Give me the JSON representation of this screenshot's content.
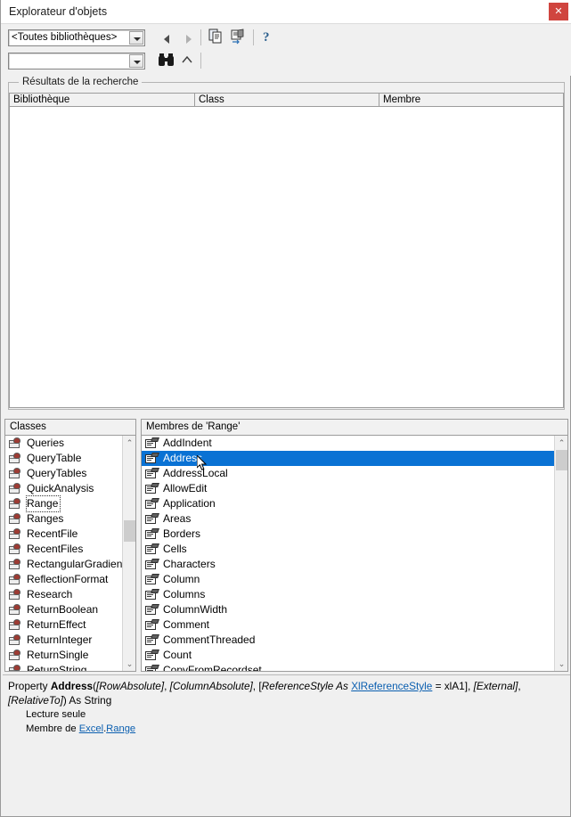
{
  "window": {
    "title": "Explorateur d'objets",
    "close_label": "✕",
    "close_color": "#d0453f"
  },
  "toolbar": {
    "library_combo": {
      "value": "<Toutes bibliothèques>",
      "placeholder": ""
    },
    "search_combo": {
      "value": "",
      "placeholder": ""
    },
    "buttons": [
      {
        "name": "back-button",
        "icon": "triangle-left-icon",
        "tooltip": "Précédent",
        "enabled": true
      },
      {
        "name": "forward-button",
        "icon": "triangle-right-icon",
        "tooltip": "Suivant",
        "enabled": false
      },
      {
        "name": "copy-button",
        "icon": "copy-icon",
        "tooltip": "Copier",
        "enabled": true
      },
      {
        "name": "view-definition-button",
        "icon": "view-definition-icon",
        "tooltip": "Afficher la définition",
        "enabled": true
      },
      {
        "name": "help-button",
        "icon": "question-mark-icon",
        "tooltip": "Aide",
        "enabled": true
      },
      {
        "name": "search-button",
        "icon": "binoculars-icon",
        "tooltip": "Rechercher",
        "enabled": true
      },
      {
        "name": "toggle-results-button",
        "icon": "chevron-up-icon",
        "tooltip": "Masquer les résultats",
        "enabled": true
      }
    ]
  },
  "results": {
    "group_label": "Résultats de la recherche",
    "columns": [
      "Bibliothèque",
      "Class",
      "Membre"
    ],
    "rows": []
  },
  "classes_panel": {
    "header": "Classes",
    "items": [
      {
        "label": "Queries",
        "icon": "class-icon"
      },
      {
        "label": "QueryTable",
        "icon": "class-icon"
      },
      {
        "label": "QueryTables",
        "icon": "class-icon"
      },
      {
        "label": "QuickAnalysis",
        "icon": "class-icon"
      },
      {
        "label": "Range",
        "icon": "class-icon",
        "focused": true
      },
      {
        "label": "Ranges",
        "icon": "class-icon"
      },
      {
        "label": "RecentFile",
        "icon": "class-icon"
      },
      {
        "label": "RecentFiles",
        "icon": "class-icon"
      },
      {
        "label": "RectangularGradien",
        "icon": "class-icon"
      },
      {
        "label": "ReflectionFormat",
        "icon": "class-icon"
      },
      {
        "label": "Research",
        "icon": "class-icon"
      },
      {
        "label": "ReturnBoolean",
        "icon": "class-icon"
      },
      {
        "label": "ReturnEffect",
        "icon": "class-icon"
      },
      {
        "label": "ReturnInteger",
        "icon": "class-icon"
      },
      {
        "label": "ReturnSingle",
        "icon": "class-icon"
      },
      {
        "label": "ReturnString",
        "icon": "class-icon"
      }
    ],
    "scrollbar": {
      "up": "⌃",
      "down": "⌄",
      "thumb_top_pct": 34,
      "thumb_height_pct": 10
    }
  },
  "members_panel": {
    "header": "Membres de 'Range'",
    "selected": "Address",
    "items": [
      {
        "label": "AddIndent",
        "icon": "property-icon"
      },
      {
        "label": "Address",
        "icon": "property-icon",
        "selected": true
      },
      {
        "label": "AddressLocal",
        "icon": "property-icon"
      },
      {
        "label": "AllowEdit",
        "icon": "property-icon"
      },
      {
        "label": "Application",
        "icon": "property-icon"
      },
      {
        "label": "Areas",
        "icon": "property-icon"
      },
      {
        "label": "Borders",
        "icon": "property-icon"
      },
      {
        "label": "Cells",
        "icon": "property-icon"
      },
      {
        "label": "Characters",
        "icon": "property-icon"
      },
      {
        "label": "Column",
        "icon": "property-icon"
      },
      {
        "label": "Columns",
        "icon": "property-icon"
      },
      {
        "label": "ColumnWidth",
        "icon": "property-icon"
      },
      {
        "label": "Comment",
        "icon": "property-icon"
      },
      {
        "label": "CommentThreaded",
        "icon": "property-icon"
      },
      {
        "label": "Count",
        "icon": "property-icon"
      },
      {
        "label": "CopyFromRecordset",
        "icon": "property-icon"
      }
    ],
    "scrollbar": {
      "up": "⌃",
      "down": "⌄",
      "thumb_top_pct": 0,
      "thumb_height_pct": 10
    }
  },
  "detail": {
    "keyword_property": "Property",
    "member_name": "Address",
    "signature_parts": {
      "open": "(",
      "p1": "[RowAbsolute]",
      "sep1": ", ",
      "p2": "[ColumnAbsolute]",
      "sep2": ", ",
      "p3_open": "[",
      "p3_name": "ReferenceStyle",
      "p3_as": " As ",
      "p3_type": "XlReferenceStyle",
      "p3_default": " = xlA1]",
      "sep3": ", ",
      "p4": "[External]",
      "sep4": ", ",
      "p5": "[RelativeTo]",
      "close": ")",
      "returns": " As String"
    },
    "readonly_text": "Lecture seule",
    "member_of_prefix": "Membre de ",
    "member_of_library": "Excel",
    "member_of_dot": ".",
    "member_of_class": "Range"
  }
}
